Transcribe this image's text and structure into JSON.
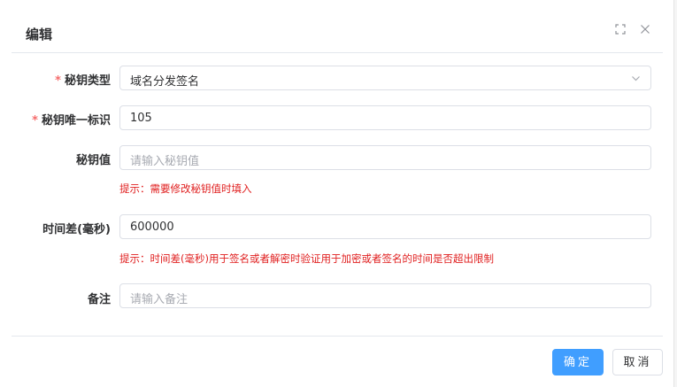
{
  "dialog": {
    "title": "编辑",
    "fullscreen_icon": "fullscreen-icon",
    "close_icon": "close-icon"
  },
  "form": {
    "key_type": {
      "label": "秘钥类型",
      "required": "*",
      "value": "域名分发签名"
    },
    "key_id": {
      "label": "秘钥唯一标识",
      "required": "*",
      "value": "105"
    },
    "key_value": {
      "label": "秘钥值",
      "placeholder": "请输入秘钥值",
      "hint": "提示：需要修改秘钥值时填入"
    },
    "time_diff": {
      "label": "时间差(毫秒)",
      "value": "600000",
      "hint": "提示：时间差(毫秒)用于签名或者解密时验证用于加密或者签名的时间是否超出限制"
    },
    "remark": {
      "label": "备注",
      "placeholder": "请输入备注"
    }
  },
  "footer": {
    "ok_label": "确定",
    "cancel_label": "取消"
  },
  "colors": {
    "primary": "#409eff",
    "required": "#f56c6c",
    "hint": "#e02020"
  }
}
